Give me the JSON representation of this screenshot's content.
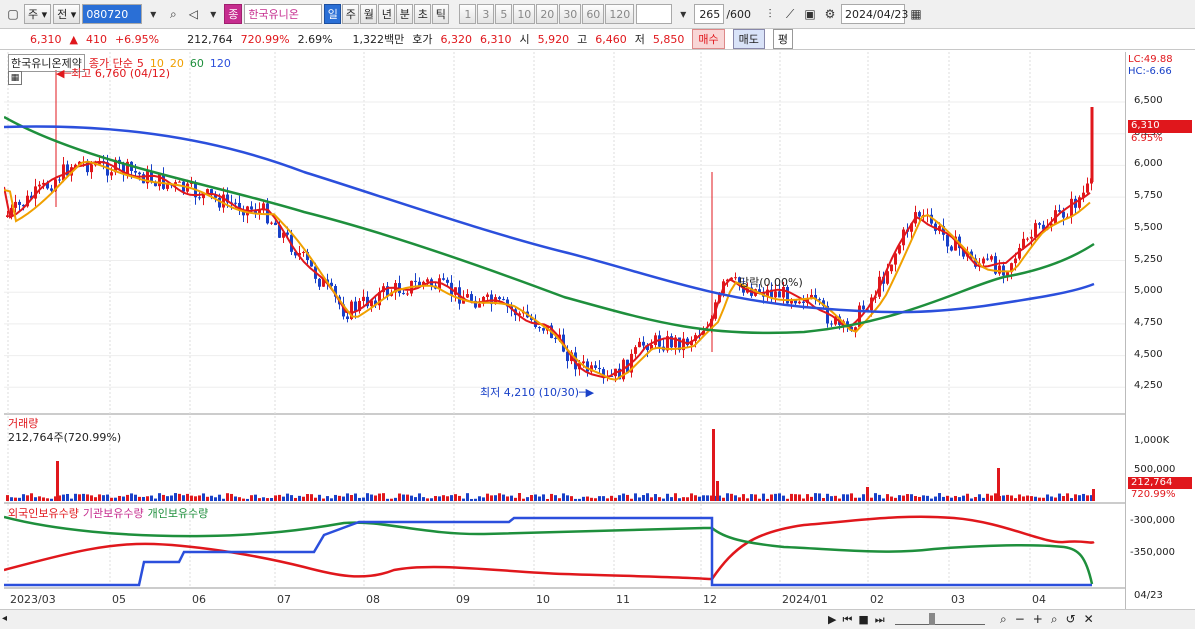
{
  "toolbar": {
    "market": "주",
    "prev": "전",
    "code": "080720",
    "stock_type_badge": "종",
    "stock_name": "한국유니온",
    "periods": [
      "일",
      "주",
      "월",
      "년",
      "분",
      "초",
      "틱"
    ],
    "period_selected": "일",
    "intervals": [
      "1",
      "3",
      "5",
      "10",
      "20",
      "30",
      "60",
      "120"
    ],
    "count_display": "265",
    "count_total": "/600",
    "date": "2024/04/23"
  },
  "quote": {
    "price": "6,310",
    "change": "410",
    "change_pct": "+6.95%",
    "volume": "212,764",
    "volume_pct": "720.99%",
    "turnover": "2.69%",
    "amount": "1,322백만",
    "bid_label": "호가",
    "ask": "6,320",
    "bid": "6,310",
    "open_label": "시",
    "open": "5,920",
    "high_label": "고",
    "high": "6,460",
    "low_label": "저",
    "low": "5,850",
    "buy_btn": "매수",
    "sell_btn": "매도",
    "flat_btn": "평"
  },
  "price_pane": {
    "title": "한국유니온제약",
    "ma_label": "종가 단순",
    "ma_periods": [
      "5",
      "10",
      "20",
      "60",
      "120"
    ],
    "ma_colors": [
      "#e0171c",
      "#f0a000",
      "#f0a000",
      "#1e8f3c",
      "#2b4fdc"
    ],
    "high_annot": "최고 6,760 (04/12)",
    "low_annot": "최저 4,210 (10/30)",
    "mid_annot": "당락(0.00%)",
    "axis_labels": [
      "6,500",
      "6,250",
      "6,000",
      "5,750",
      "5,500",
      "5,250",
      "5,000",
      "4,750",
      "4,500",
      "4,250"
    ],
    "axis_top1": "LC:49.88",
    "axis_top2": "HC:-6.66",
    "cur_price_tag": "6,310",
    "cur_pct_tag": "6.95%"
  },
  "volume_pane": {
    "title": "거래량",
    "value": "212,764주(720.99%)",
    "axis_labels": [
      "1,000K",
      "500,000"
    ],
    "cur_tag": "212,764",
    "cur_pct": "720.99%"
  },
  "holding_pane": {
    "foreign": "외국인보유수량",
    "institution": "기관보유수량",
    "individual": "개인보유수량",
    "axis_labels": [
      "-300,000",
      "-350,000"
    ]
  },
  "xaxis": [
    "2023/03",
    "05",
    "06",
    "07",
    "08",
    "09",
    "10",
    "11",
    "12",
    "2024/01",
    "02",
    "03",
    "04"
  ],
  "xaxis_end": "04/23"
}
